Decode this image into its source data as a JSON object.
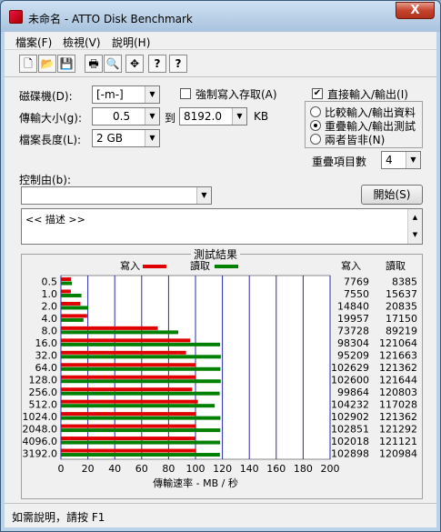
{
  "window": {
    "title": "未命名 - ATTO Disk Benchmark",
    "close_symbol": "X"
  },
  "menu": [
    "檔案(F)",
    "檢視(V)",
    "說明(H)"
  ],
  "toolbar": [
    {
      "name": "new-icon",
      "glyph": "🗋"
    },
    {
      "name": "open-icon",
      "glyph": "📂"
    },
    {
      "name": "save-icon",
      "glyph": "💾"
    },
    {
      "name": "print-icon",
      "glyph": "🖶"
    },
    {
      "name": "print-preview-icon",
      "glyph": "🔍"
    },
    {
      "name": "move-icon",
      "glyph": "✥"
    },
    {
      "name": "help-icon",
      "glyph": "?"
    },
    {
      "name": "context-help-icon",
      "glyph": "?"
    }
  ],
  "settings": {
    "drive_label": "磁碟機(D):",
    "drive_value": "[-m-]",
    "transfer_label": "傳輸大小(g):",
    "transfer_from": "0.5",
    "transfer_to_label": "到",
    "transfer_to": "8192.0",
    "transfer_unit": "KB",
    "file_length_label": "檔案長度(L):",
    "file_length_value": "2 GB",
    "force_write_label": "強制寫入存取(A)",
    "force_write_checked": false,
    "direct_io_label": "直接輸入/輸出(I)",
    "direct_io_checked": true,
    "io_modes": [
      "比較輸入/輸出資料",
      "重疊輸入/輸出測試",
      "兩者皆非(N)"
    ],
    "io_mode_selected": 1,
    "queue_label": "重疊項目數",
    "queue_value": "4",
    "controlled_by_label": "控制由(b):",
    "controlled_by_value": "",
    "start_button": "開始(S)",
    "description_text": "<<    描述    >>"
  },
  "results": {
    "title": "測試結果",
    "legend_write": "寫入",
    "legend_read": "讀取",
    "col_write": "寫入",
    "col_read": "讀取",
    "write_color": "#e00000",
    "read_color": "#008000"
  },
  "chart_data": {
    "type": "bar",
    "orientation": "horizontal",
    "categories": [
      "0.5",
      "1.0",
      "2.0",
      "4.0",
      "8.0",
      "16.0",
      "32.0",
      "64.0",
      "128.0",
      "256.0",
      "512.0",
      "1024.0",
      "2048.0",
      "4096.0",
      "3192.0"
    ],
    "series": [
      {
        "name": "寫入",
        "values": [
          7769,
          7550,
          14840,
          19957,
          73728,
          98304,
          95209,
          102629,
          102600,
          99864,
          104232,
          102902,
          102851,
          102018,
          102898
        ]
      },
      {
        "name": "讀取",
        "values": [
          8385,
          15637,
          20835,
          17150,
          89219,
          121064,
          121663,
          121362,
          121644,
          120803,
          117028,
          121362,
          121292,
          121121,
          120984
        ]
      }
    ],
    "xlabel": "傳輸速率 - MB / 秒",
    "xlim": [
      0,
      200
    ],
    "xticks": [
      0,
      20,
      40,
      60,
      80,
      100,
      120,
      140,
      160,
      180,
      200
    ],
    "grid": true,
    "legend": "top-center"
  },
  "status": {
    "text": "如需說明，請按 F1"
  }
}
